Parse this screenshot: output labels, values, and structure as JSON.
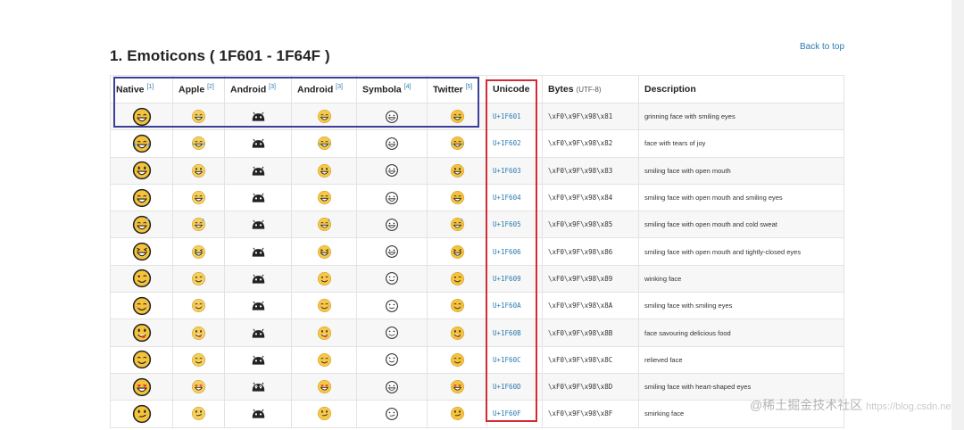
{
  "back_to_top": "Back to top",
  "section_title": "1. Emoticons ( 1F601 - 1F64F )",
  "headers": [
    {
      "label": "Native",
      "ref": "[1]"
    },
    {
      "label": "Apple",
      "ref": "[2]"
    },
    {
      "label": "Android",
      "ref": "[3]"
    },
    {
      "label": "Android",
      "ref": "[3]"
    },
    {
      "label": "Symbola",
      "ref": "[4]"
    },
    {
      "label": "Twitter",
      "ref": "[5]"
    },
    {
      "label": "Unicode",
      "ref": ""
    },
    {
      "label": "Bytes",
      "ref": "",
      "sub": "(UTF-8)"
    },
    {
      "label": "Description",
      "ref": ""
    }
  ],
  "rows": [
    {
      "unicode": "U+1F601",
      "bytes": "\\xF0\\x9F\\x98\\x81",
      "description": "grinning face with smiling eyes",
      "expr": "grin"
    },
    {
      "unicode": "U+1F602",
      "bytes": "\\xF0\\x9F\\x98\\x82",
      "description": "face with tears of joy",
      "expr": "tears"
    },
    {
      "unicode": "U+1F603",
      "bytes": "\\xF0\\x9F\\x98\\x83",
      "description": "smiling face with open mouth",
      "expr": "open"
    },
    {
      "unicode": "U+1F604",
      "bytes": "\\xF0\\x9F\\x98\\x84",
      "description": "smiling face with open mouth and smiling eyes",
      "expr": "open-smile"
    },
    {
      "unicode": "U+1F605",
      "bytes": "\\xF0\\x9F\\x98\\x85",
      "description": "smiling face with open mouth and cold sweat",
      "expr": "sweat"
    },
    {
      "unicode": "U+1F606",
      "bytes": "\\xF0\\x9F\\x98\\x86",
      "description": "smiling face with open mouth and tightly-closed eyes",
      "expr": "squint"
    },
    {
      "unicode": "U+1F609",
      "bytes": "\\xF0\\x9F\\x98\\x89",
      "description": "winking face",
      "expr": "wink"
    },
    {
      "unicode": "U+1F60A",
      "bytes": "\\xF0\\x9F\\x98\\x8A",
      "description": "smiling face with smiling eyes",
      "expr": "blush"
    },
    {
      "unicode": "U+1F60B",
      "bytes": "\\xF0\\x9F\\x98\\x8B",
      "description": "face savouring delicious food",
      "expr": "tongue"
    },
    {
      "unicode": "U+1F60C",
      "bytes": "\\xF0\\x9F\\x98\\x8C",
      "description": "relieved face",
      "expr": "relieved"
    },
    {
      "unicode": "U+1F60D",
      "bytes": "\\xF0\\x9F\\x98\\x8D",
      "description": "smiling face with heart-shaped eyes",
      "expr": "hearts"
    },
    {
      "unicode": "U+1F60F",
      "bytes": "\\xF0\\x9F\\x98\\x8F",
      "description": "smirking face",
      "expr": "smirk"
    }
  ],
  "watermark": {
    "site": "@稀土掘金技术社区",
    "url": "https://blog.csdn.net"
  },
  "colors": {
    "link": "#2a7ab0",
    "highlight_blue": "#3c3f98",
    "highlight_red": "#d42a33",
    "emoji_yellow": "#f5c33b",
    "emoji_outline": "#222222"
  }
}
